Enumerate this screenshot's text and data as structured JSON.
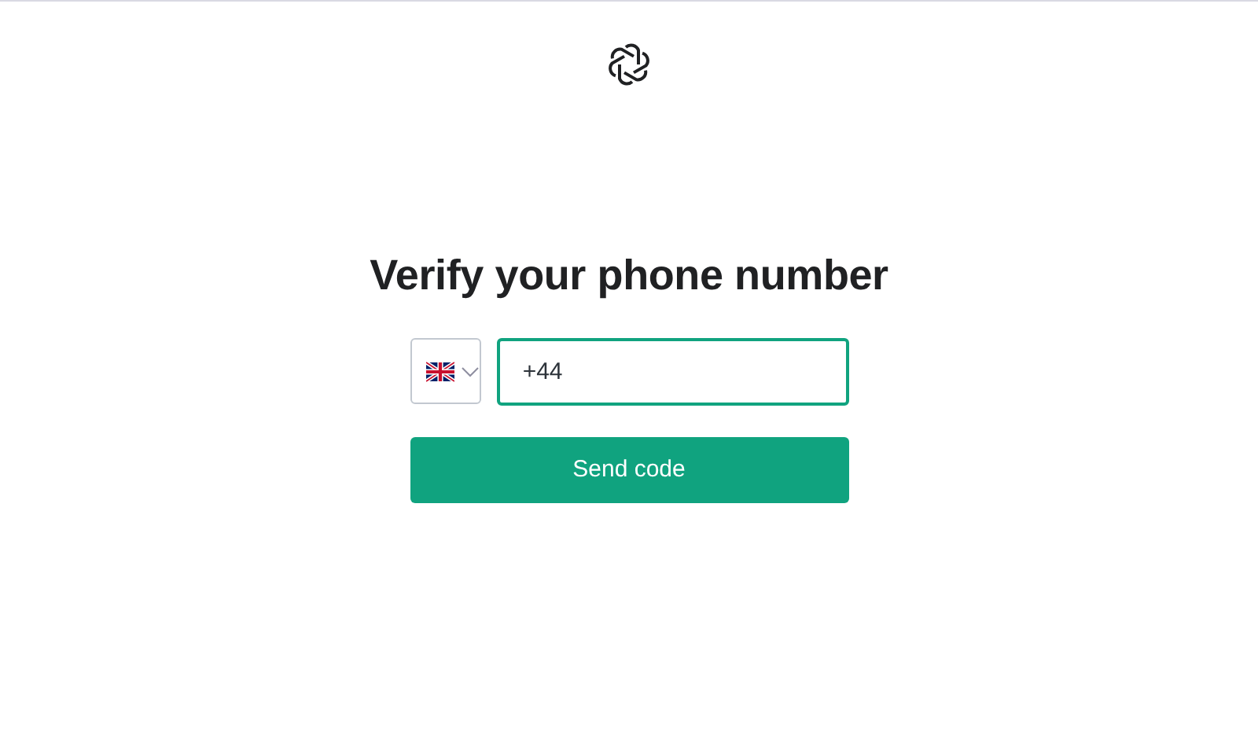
{
  "heading": "Verify your phone number",
  "country_select": {
    "expanded": false
  },
  "phone_field": {
    "value": "+44",
    "focused": true
  },
  "submit_button": {
    "label": "Send code"
  }
}
